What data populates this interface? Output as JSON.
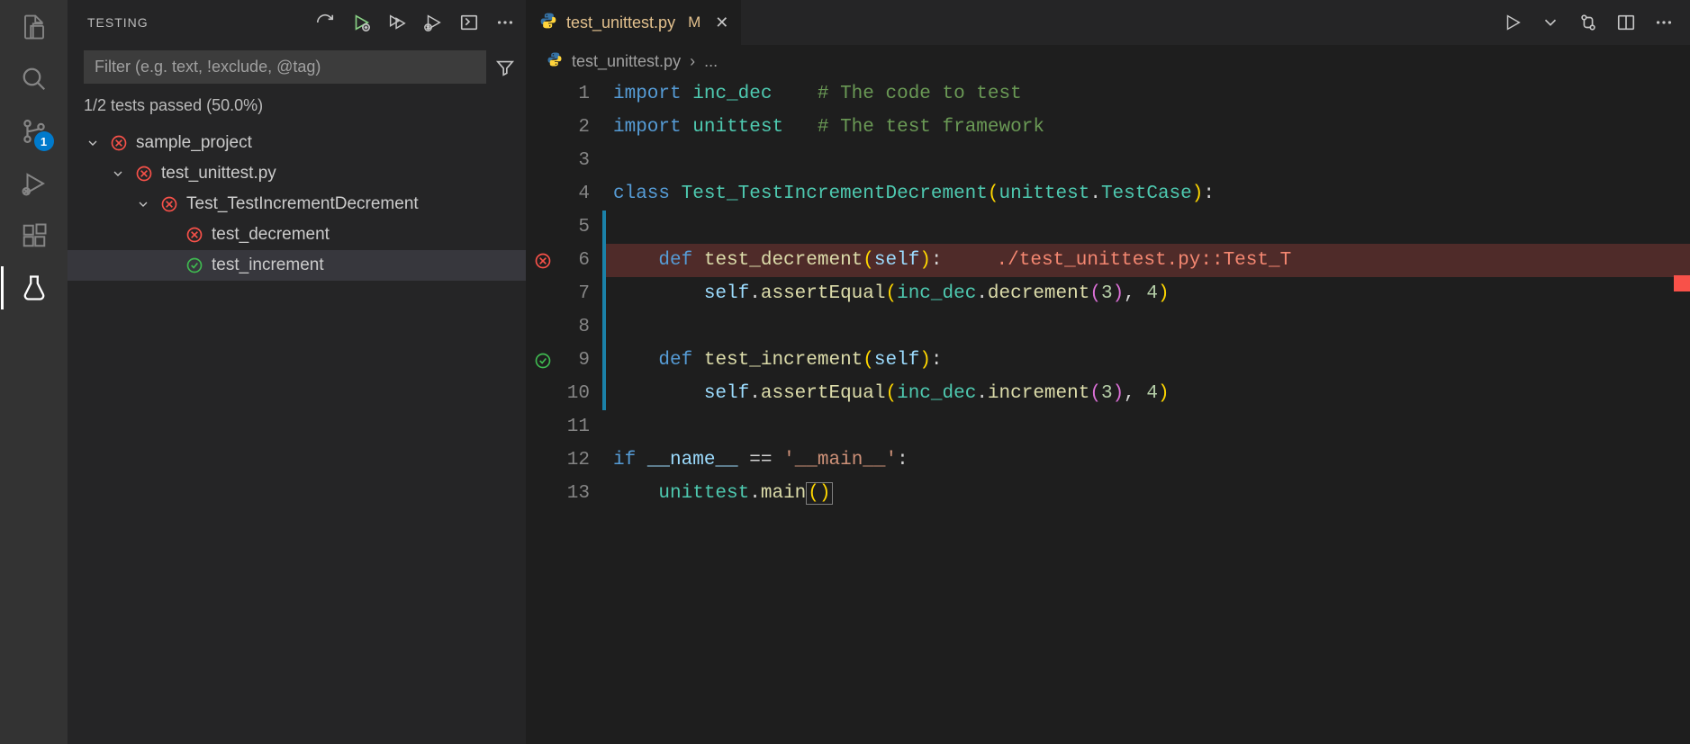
{
  "activity": {
    "items": [
      {
        "name": "explorer",
        "icon": "files"
      },
      {
        "name": "search",
        "icon": "search"
      },
      {
        "name": "source-control",
        "icon": "git",
        "badge": "1"
      },
      {
        "name": "run-debug",
        "icon": "debug"
      },
      {
        "name": "extensions",
        "icon": "extensions"
      },
      {
        "name": "testing",
        "icon": "flask",
        "active": true
      }
    ]
  },
  "sidebar": {
    "title": "TESTING",
    "filter_placeholder": "Filter (e.g. text, !exclude, @tag)",
    "status": "1/2 tests passed (50.0%)",
    "tree": [
      {
        "indent": 0,
        "expanded": true,
        "status": "fail",
        "label": "sample_project"
      },
      {
        "indent": 1,
        "expanded": true,
        "status": "fail",
        "label": "test_unittest.py"
      },
      {
        "indent": 2,
        "expanded": true,
        "status": "fail",
        "label": "Test_TestIncrementDecrement"
      },
      {
        "indent": 3,
        "leaf": true,
        "status": "fail",
        "label": "test_decrement"
      },
      {
        "indent": 3,
        "leaf": true,
        "status": "pass",
        "label": "test_increment",
        "selected": true
      }
    ]
  },
  "tab": {
    "filename": "test_unittest.py",
    "modified_marker": "M"
  },
  "breadcrumb": {
    "file": "test_unittest.py",
    "rest": "..."
  },
  "code": {
    "lines": [
      {
        "n": 1,
        "html": "<span class='kw'>import</span> <span class='cls'>inc_dec</span>    <span class='cmt'># The code to test</span>"
      },
      {
        "n": 2,
        "html": "<span class='kw'>import</span> <span class='cls'>unittest</span>   <span class='cmt'># The test framework</span>"
      },
      {
        "n": 3,
        "html": ""
      },
      {
        "n": 4,
        "html": "<span class='kw'>class</span> <span class='cls'>Test_TestIncrementDecrement</span><span class='br-y'>(</span><span class='cls'>unittest</span><span class='punct'>.</span><span class='cls'>TestCase</span><span class='br-y'>)</span><span class='punct'>:</span>"
      },
      {
        "n": 5,
        "html": "",
        "bar": true
      },
      {
        "n": 6,
        "html": "    <span class='kw'>def</span> <span class='fn'>test_decrement</span><span class='br-y'>(</span><span class='param'>self</span><span class='br-y'>)</span><span class='punct'>:</span>",
        "bar": true,
        "err": true,
        "glyph": "fail",
        "inline_err": "./test_unittest.py::Test_T"
      },
      {
        "n": 7,
        "html": "        <span class='param'>self</span><span class='punct'>.</span><span class='fn'>assertEqual</span><span class='br-y'>(</span><span class='cls'>inc_dec</span><span class='punct'>.</span><span class='fn'>decrement</span><span class='br-p'>(</span><span class='num'>3</span><span class='br-p'>)</span><span class='punct'>,</span> <span class='num'>4</span><span class='br-y'>)</span>",
        "bar": true
      },
      {
        "n": 8,
        "html": "",
        "bar": true
      },
      {
        "n": 9,
        "html": "    <span class='kw'>def</span> <span class='fn'>test_increment</span><span class='br-y'>(</span><span class='param'>self</span><span class='br-y'>)</span><span class='punct'>:</span>",
        "bar": true,
        "glyph": "pass"
      },
      {
        "n": 10,
        "html": "        <span class='param'>self</span><span class='punct'>.</span><span class='fn'>assertEqual</span><span class='br-y'>(</span><span class='cls'>inc_dec</span><span class='punct'>.</span><span class='fn'>increment</span><span class='br-p'>(</span><span class='num'>3</span><span class='br-p'>)</span><span class='punct'>,</span> <span class='num'>4</span><span class='br-y'>)</span>",
        "bar": true
      },
      {
        "n": 11,
        "html": ""
      },
      {
        "n": 12,
        "html": "<span class='kw'>if</span> <span class='param'>__name__</span> <span class='punct'>==</span> <span class='str'>'__main__'</span><span class='punct'>:</span>"
      },
      {
        "n": 13,
        "html": "    <span class='cls'>unittest</span><span class='punct'>.</span><span class='fn'>main</span><span class='cursor-box'><span class='br-y'>()</span></span>"
      }
    ]
  }
}
